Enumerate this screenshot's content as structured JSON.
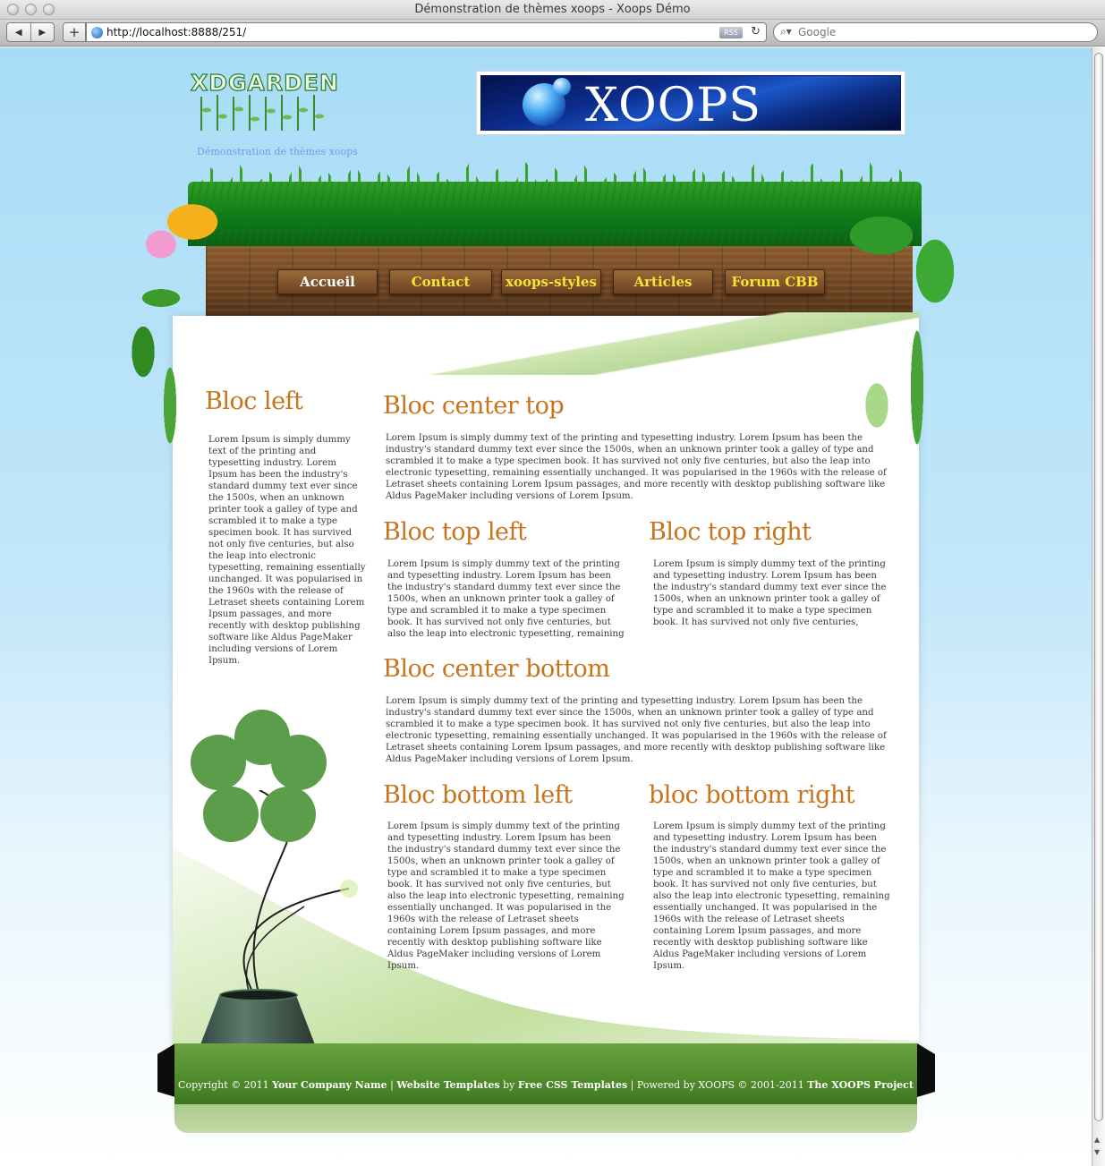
{
  "browser": {
    "window_title": "Démonstration de thèmes xoops - Xoops Démo",
    "url": "http://localhost:8888/251/",
    "rss_label": "RSS",
    "search_placeholder": "Google"
  },
  "site": {
    "logo_text": "XDGARDEN",
    "slogan": "Démonstration de thèmes xoops",
    "banner_text": "XOOPS"
  },
  "nav": {
    "items": [
      {
        "label": "Accueil",
        "active": true
      },
      {
        "label": "Contact",
        "active": false
      },
      {
        "label": "xoops-styles",
        "active": false
      },
      {
        "label": "Articles",
        "active": false
      },
      {
        "label": "Forum CBB",
        "active": false
      }
    ]
  },
  "blocks": {
    "left": {
      "title": "Bloc left",
      "text": "Lorem Ipsum is simply dummy text of the printing and typesetting industry. Lorem Ipsum has been the industry's standard dummy text ever since the 1500s, when an unknown printer took a galley of type and scrambled it to make a type specimen book. It has survived not only five centuries, but also the leap into electronic typesetting, remaining essentially unchanged. It was popularised in the 1960s with the release of Letraset sheets containing Lorem Ipsum passages, and more recently with desktop publishing software like Aldus PageMaker including versions of Lorem Ipsum."
    },
    "center_top": {
      "title": "Bloc center top",
      "text": "Lorem Ipsum is simply dummy text of the printing and typesetting industry. Lorem Ipsum has been the industry's standard dummy text ever since the 1500s, when an unknown printer took a galley of type and scrambled it to make a type specimen book. It has survived not only five centuries, but also the leap into electronic typesetting, remaining essentially unchanged. It was popularised in the 1960s with the release of Letraset sheets containing Lorem Ipsum passages, and more recently with desktop publishing software like Aldus PageMaker including versions of Lorem Ipsum."
    },
    "top_left": {
      "title": "Bloc top left",
      "text": "Lorem Ipsum is simply dummy text of the printing and typesetting industry. Lorem Ipsum has been the industry's standard dummy text ever since the 1500s, when an unknown printer took a galley of type and scrambled it to make a type specimen book. It has survived not only five centuries, but also the leap into electronic typesetting, remaining"
    },
    "top_right": {
      "title": "Bloc top right",
      "text": "Lorem Ipsum is simply dummy text of the printing and typesetting industry. Lorem Ipsum has been the industry's standard dummy text ever since the 1500s, when an unknown printer took a galley of type and scrambled it to make a type specimen book. It has survived not only five centuries,"
    },
    "center_bottom": {
      "title": "Bloc center bottom",
      "text": "Lorem Ipsum is simply dummy text of the printing and typesetting industry. Lorem Ipsum has been the industry's standard dummy text ever since the 1500s, when an unknown printer took a galley of type and scrambled it to make a type specimen book. It has survived not only five centuries, but also the leap into electronic typesetting, remaining essentially unchanged. It was popularised in the 1960s with the release of Letraset sheets containing Lorem Ipsum passages, and more recently with desktop publishing software like Aldus PageMaker including versions of Lorem Ipsum."
    },
    "bottom_left": {
      "title": "Bloc bottom left",
      "text": "Lorem Ipsum is simply dummy text of the printing and typesetting industry. Lorem Ipsum has been the industry's standard dummy text ever since the 1500s, when an unknown printer took a galley of type and scrambled it to make a type specimen book. It has survived not only five centuries, but also the leap into electronic typesetting, remaining essentially unchanged. It was popularised in the 1960s with the release of Letraset sheets containing Lorem Ipsum passages, and more recently with desktop publishing software like Aldus PageMaker including versions of Lorem Ipsum."
    },
    "bottom_right": {
      "title": "bloc bottom right",
      "text": "Lorem Ipsum is simply dummy text of the printing and typesetting industry. Lorem Ipsum has been the industry's standard dummy text ever since the 1500s, when an unknown printer took a galley of type and scrambled it to make a type specimen book. It has survived not only five centuries, but also the leap into electronic typesetting, remaining essentially unchanged. It was popularised in the 1960s with the release of Letraset sheets containing Lorem Ipsum passages, and more recently with desktop publishing software like Aldus PageMaker including versions of Lorem Ipsum."
    }
  },
  "footer": {
    "copyright_prefix": "Copyright © 2011",
    "company": "Your Company Name",
    "sep1": "|",
    "templates_link": "Website Templates",
    "by": "by",
    "free_css": "Free CSS Templates",
    "powered": "| Powered by XOOPS © 2001-2011",
    "project": "The XOOPS Project"
  },
  "colors": {
    "title_orange": "#c8741c",
    "nav_yellow": "#f7e43a",
    "footer_green": "#4f8b2b",
    "sky_blue": "#a8dcf6"
  },
  "icons": [
    "back-arrow-icon",
    "forward-arrow-icon",
    "add-bookmark-icon",
    "globe-icon",
    "reload-icon",
    "search-icon"
  ]
}
